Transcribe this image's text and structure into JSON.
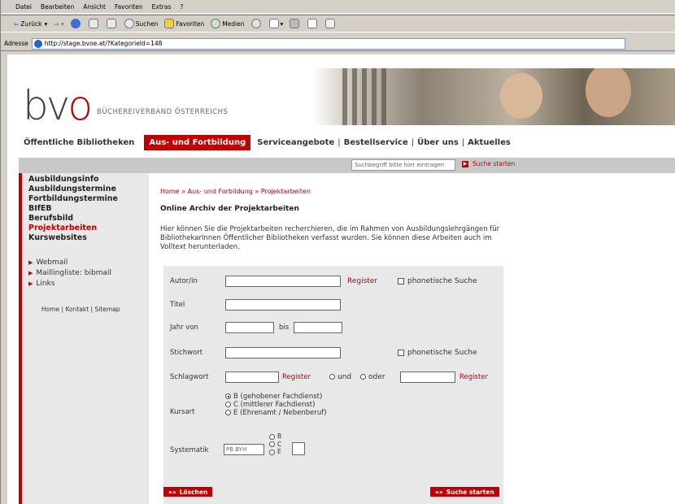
{
  "browser": {
    "menu": [
      "Datei",
      "Bearbeiten",
      "Ansicht",
      "Favoriten",
      "Extras",
      "?"
    ],
    "toolbar": {
      "back": "Zurück",
      "search": "Suchen",
      "favorites": "Favoriten",
      "media": "Medien"
    },
    "address_label": "Adresse",
    "address_url": "http://stage.bvoe.at/?KategorieId=148"
  },
  "header": {
    "logo_text_prefix": "bv",
    "logo_text_o": "o",
    "logo_subtitle": "BÜCHEREIVERBAND ÖSTERREICHS"
  },
  "nav": {
    "first": "Öffentliche Bibliotheken",
    "active": "Aus- und Fortbildung",
    "items": [
      "Serviceangebote",
      "Bestellservice",
      "Über uns",
      "Aktuelles"
    ],
    "separator": "|"
  },
  "search": {
    "placeholder": "Suchbegriff bitte hier eintragen",
    "button": "Suche starten"
  },
  "sidebar": {
    "main_links": [
      "Ausbildungsinfo",
      "Ausbildungstermine",
      "Fortbildungstermine",
      "BIfEB",
      "Berufsbild",
      "Projektarbeiten",
      "Kurswebsites"
    ],
    "active_index": 5,
    "sub_links": [
      "Webmail",
      "Maillingliste: bibmail",
      "Links"
    ],
    "footer": "Home | Kontakt | Sitemap"
  },
  "main": {
    "breadcrumb": "Home » Aus- und Forbildung » Projektarbeiten",
    "heading": "Online Archiv der Projektarbeiten",
    "intro": "Hier können Sie die Projektarbeiten recherchieren, die im Rahmen von Ausbildungslehrgängen für BibliothekarInnen Öffentlicher Bibliotheken verfasst wurden. Sie können diese Arbeiten auch im Volltext herunterladen."
  },
  "form": {
    "author_label": "Autor/in",
    "register": "Register",
    "phonetic": "phonetische Suche",
    "title_label": "Titel",
    "year_from": "Jahr von",
    "year_to": "bis",
    "keyword_label": "Stichwort",
    "subject_label": "Schlagwort",
    "and_label": "und",
    "or_label": "oder",
    "course_label": "Kursart",
    "course_options": [
      "B (gehobener Fachdienst)",
      "C (mittlerer Fachdienst)",
      "E (Ehrenamt / Nebenberuf)"
    ],
    "course_selected": 0,
    "system_label": "Systematik",
    "system_prefix": "PB.BYH",
    "system_options": [
      "B",
      "C",
      "E"
    ],
    "reset_button": "Löschen",
    "submit_button": "Suche starten",
    "button_arrow": "»»"
  }
}
